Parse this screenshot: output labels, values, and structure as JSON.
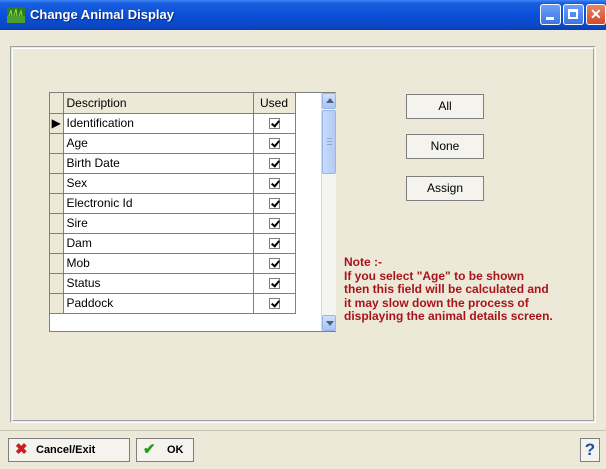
{
  "window": {
    "title": "Change Animal Display"
  },
  "grid": {
    "headers": {
      "description": "Description",
      "used": "Used"
    },
    "rows": [
      {
        "description": "Identification",
        "used": true,
        "current": true
      },
      {
        "description": "Age",
        "used": true
      },
      {
        "description": "Birth Date",
        "used": true
      },
      {
        "description": "Sex",
        "used": true
      },
      {
        "description": "Electronic Id",
        "used": true
      },
      {
        "description": "Sire",
        "used": true
      },
      {
        "description": "Dam",
        "used": true
      },
      {
        "description": "Mob",
        "used": true
      },
      {
        "description": "Status",
        "used": true
      },
      {
        "description": "Paddock",
        "used": true
      }
    ]
  },
  "buttons": {
    "all": "All",
    "none": "None",
    "assign": "Assign"
  },
  "note": {
    "heading": "Note :-",
    "lines": [
      "If you select \"Age\" to be shown",
      "then this field will be calculated and",
      "it may slow down the process of",
      "displaying the animal details screen."
    ]
  },
  "footer": {
    "cancel_exit": "Cancel/Exit",
    "ok": "OK",
    "help": "?"
  },
  "colors": {
    "title_bar": "#0a4fd6",
    "note_text": "#a8141a",
    "window_bg": "#ece9d8"
  },
  "icons": {
    "app": "grass-field-icon",
    "cancel": "red-x-icon",
    "ok": "green-check-icon",
    "help": "question-mark-icon"
  }
}
